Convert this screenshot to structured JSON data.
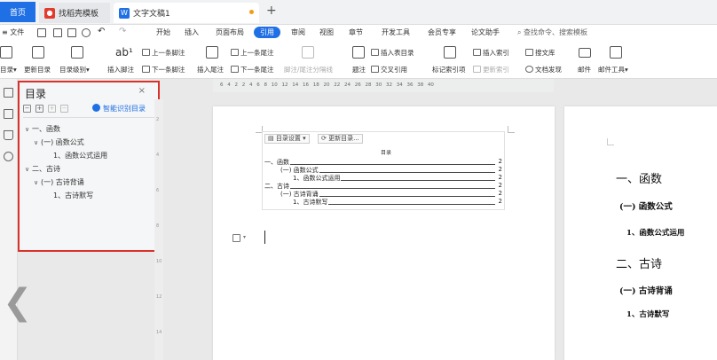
{
  "tabs": {
    "home": "首页",
    "template": "找稻壳模板",
    "document": "文字文稿1",
    "new_tab": "+"
  },
  "menu": {
    "file": "文件",
    "items": [
      "开始",
      "插入",
      "页面布局",
      "引用",
      "审阅",
      "视图",
      "章节",
      "开发工具",
      "会员专享",
      "论文助手"
    ],
    "active": "引用",
    "search": "查找命令、搜索模板"
  },
  "ribbon": {
    "toc": "目录",
    "update_toc": "更新目录",
    "toc_level": "目录级别",
    "insert_footnote": "插入脚注",
    "prev_footnote": "上一条脚注",
    "next_footnote": "下一条脚注",
    "insert_endnote": "插入尾注",
    "prev_endnote": "上一条尾注",
    "next_endnote": "下一条尾注",
    "separator": "脚注/尾注分隔线",
    "caption": "题注",
    "insert_table_toc": "插入表目录",
    "cross_ref": "交叉引用",
    "mark_index": "标记索引项",
    "insert_index": "插入索引",
    "update_index": "更新索引",
    "search_lit": "搜文库",
    "find_doc": "文档发现",
    "mail": "邮件",
    "mail_tools": "邮件工具"
  },
  "toc_panel": {
    "title": "目录",
    "close": "×",
    "smart": "智能识别目录",
    "items": [
      {
        "label": "一、函数",
        "level": 1,
        "expanded": true
      },
      {
        "label": "(一) 函数公式",
        "level": 2,
        "expanded": true
      },
      {
        "label": "1、函数公式运用",
        "level": 3
      },
      {
        "label": "二、古诗",
        "level": 1,
        "expanded": true
      },
      {
        "label": "(一) 古诗背诵",
        "level": 2,
        "expanded": true
      },
      {
        "label": "1、古诗默写",
        "level": 3
      }
    ]
  },
  "ruler": {
    "numbers": "6 4 2 2 4 6 8 10 12 14 16 18 20 22 24 26 28 30 32 34 36 38 40"
  },
  "doc_toc": {
    "settings_btn": "目录设置",
    "update_btn": "更新目录...",
    "heading": "目录",
    "lines": [
      {
        "label": "一、函数",
        "page": "2",
        "indent": 0
      },
      {
        "label": "(一) 函数公式",
        "page": "2",
        "indent": 1
      },
      {
        "label": "1、函数公式运用",
        "page": "2",
        "indent": 2
      },
      {
        "label": "二、古诗",
        "page": "2",
        "indent": 0
      },
      {
        "label": "(一) 古诗背诵",
        "page": "2",
        "indent": 1
      },
      {
        "label": "1、古诗默写",
        "page": "2",
        "indent": 2
      }
    ]
  },
  "page2": {
    "h1a": "一、函数",
    "h2a": "(一) 函数公式",
    "h3a": "1、函数公式运用",
    "h1b": "二、古诗",
    "h2b": "(一) 古诗背诵",
    "h3b": "1、古诗默写"
  },
  "colors": {
    "accent": "#1f6fe5",
    "highlight_border": "#d9322b"
  },
  "icons": {
    "back": "chevron-left-icon"
  }
}
